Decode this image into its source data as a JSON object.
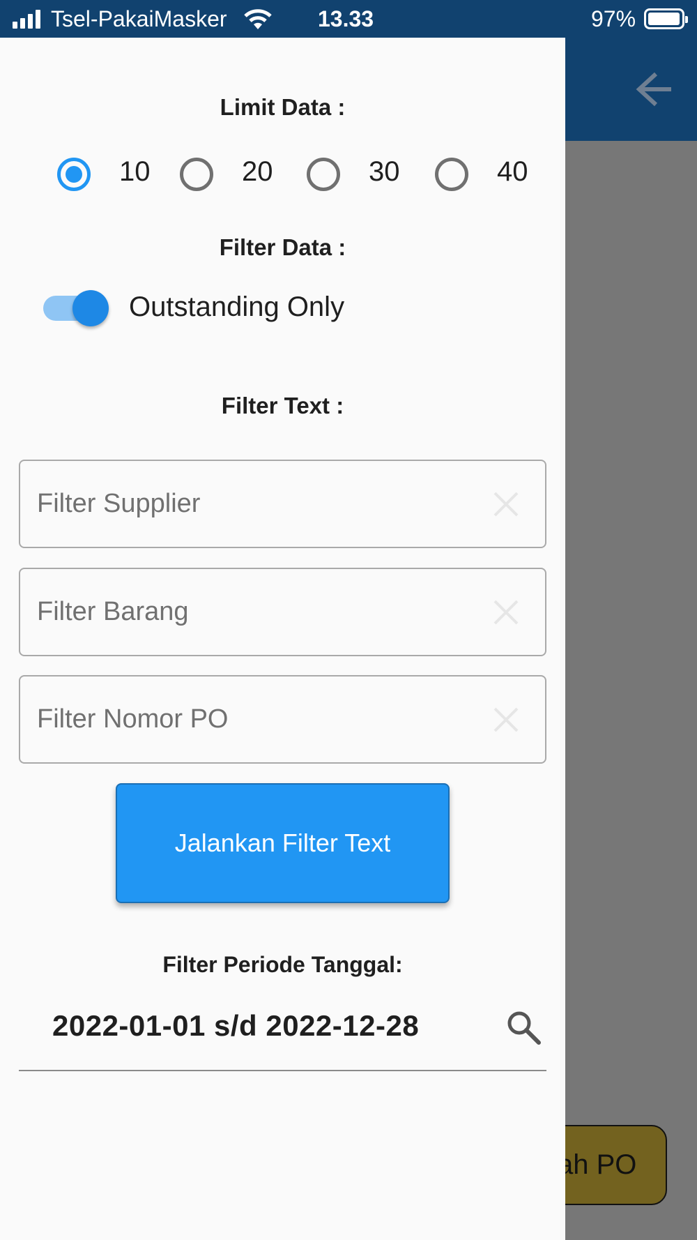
{
  "status_bar": {
    "carrier": "Tsel-PakaiMasker",
    "time": "13.33",
    "battery": "97%",
    "battery_level": 0.97,
    "icons": [
      "signal-icon",
      "wifi-icon",
      "battery-icon"
    ]
  },
  "background": {
    "back_icon": "arrow-left-icon",
    "fab_label": "ah PO"
  },
  "drawer": {
    "limit_title": "Limit Data :",
    "limit_options": [
      "10",
      "20",
      "30",
      "40"
    ],
    "limit_selected": "10",
    "filter_title": "Filter Data :",
    "outstanding_label": "Outstanding Only",
    "outstanding_on": true,
    "text_title": "Filter Text :",
    "fields": [
      {
        "placeholder": "Filter Supplier",
        "value": ""
      },
      {
        "placeholder": "Filter Barang",
        "value": ""
      },
      {
        "placeholder": "Filter Nomor PO",
        "value": ""
      }
    ],
    "run_button": "Jalankan Filter Text",
    "period_title": "Filter Periode Tanggal:",
    "period_value": "2022-01-01 s/d 2022-12-28",
    "period_icon": "search-icon"
  },
  "colors": {
    "accent": "#2196f3",
    "appbar": "#11426f",
    "fab": "#73621f",
    "scrim": "#777777"
  }
}
